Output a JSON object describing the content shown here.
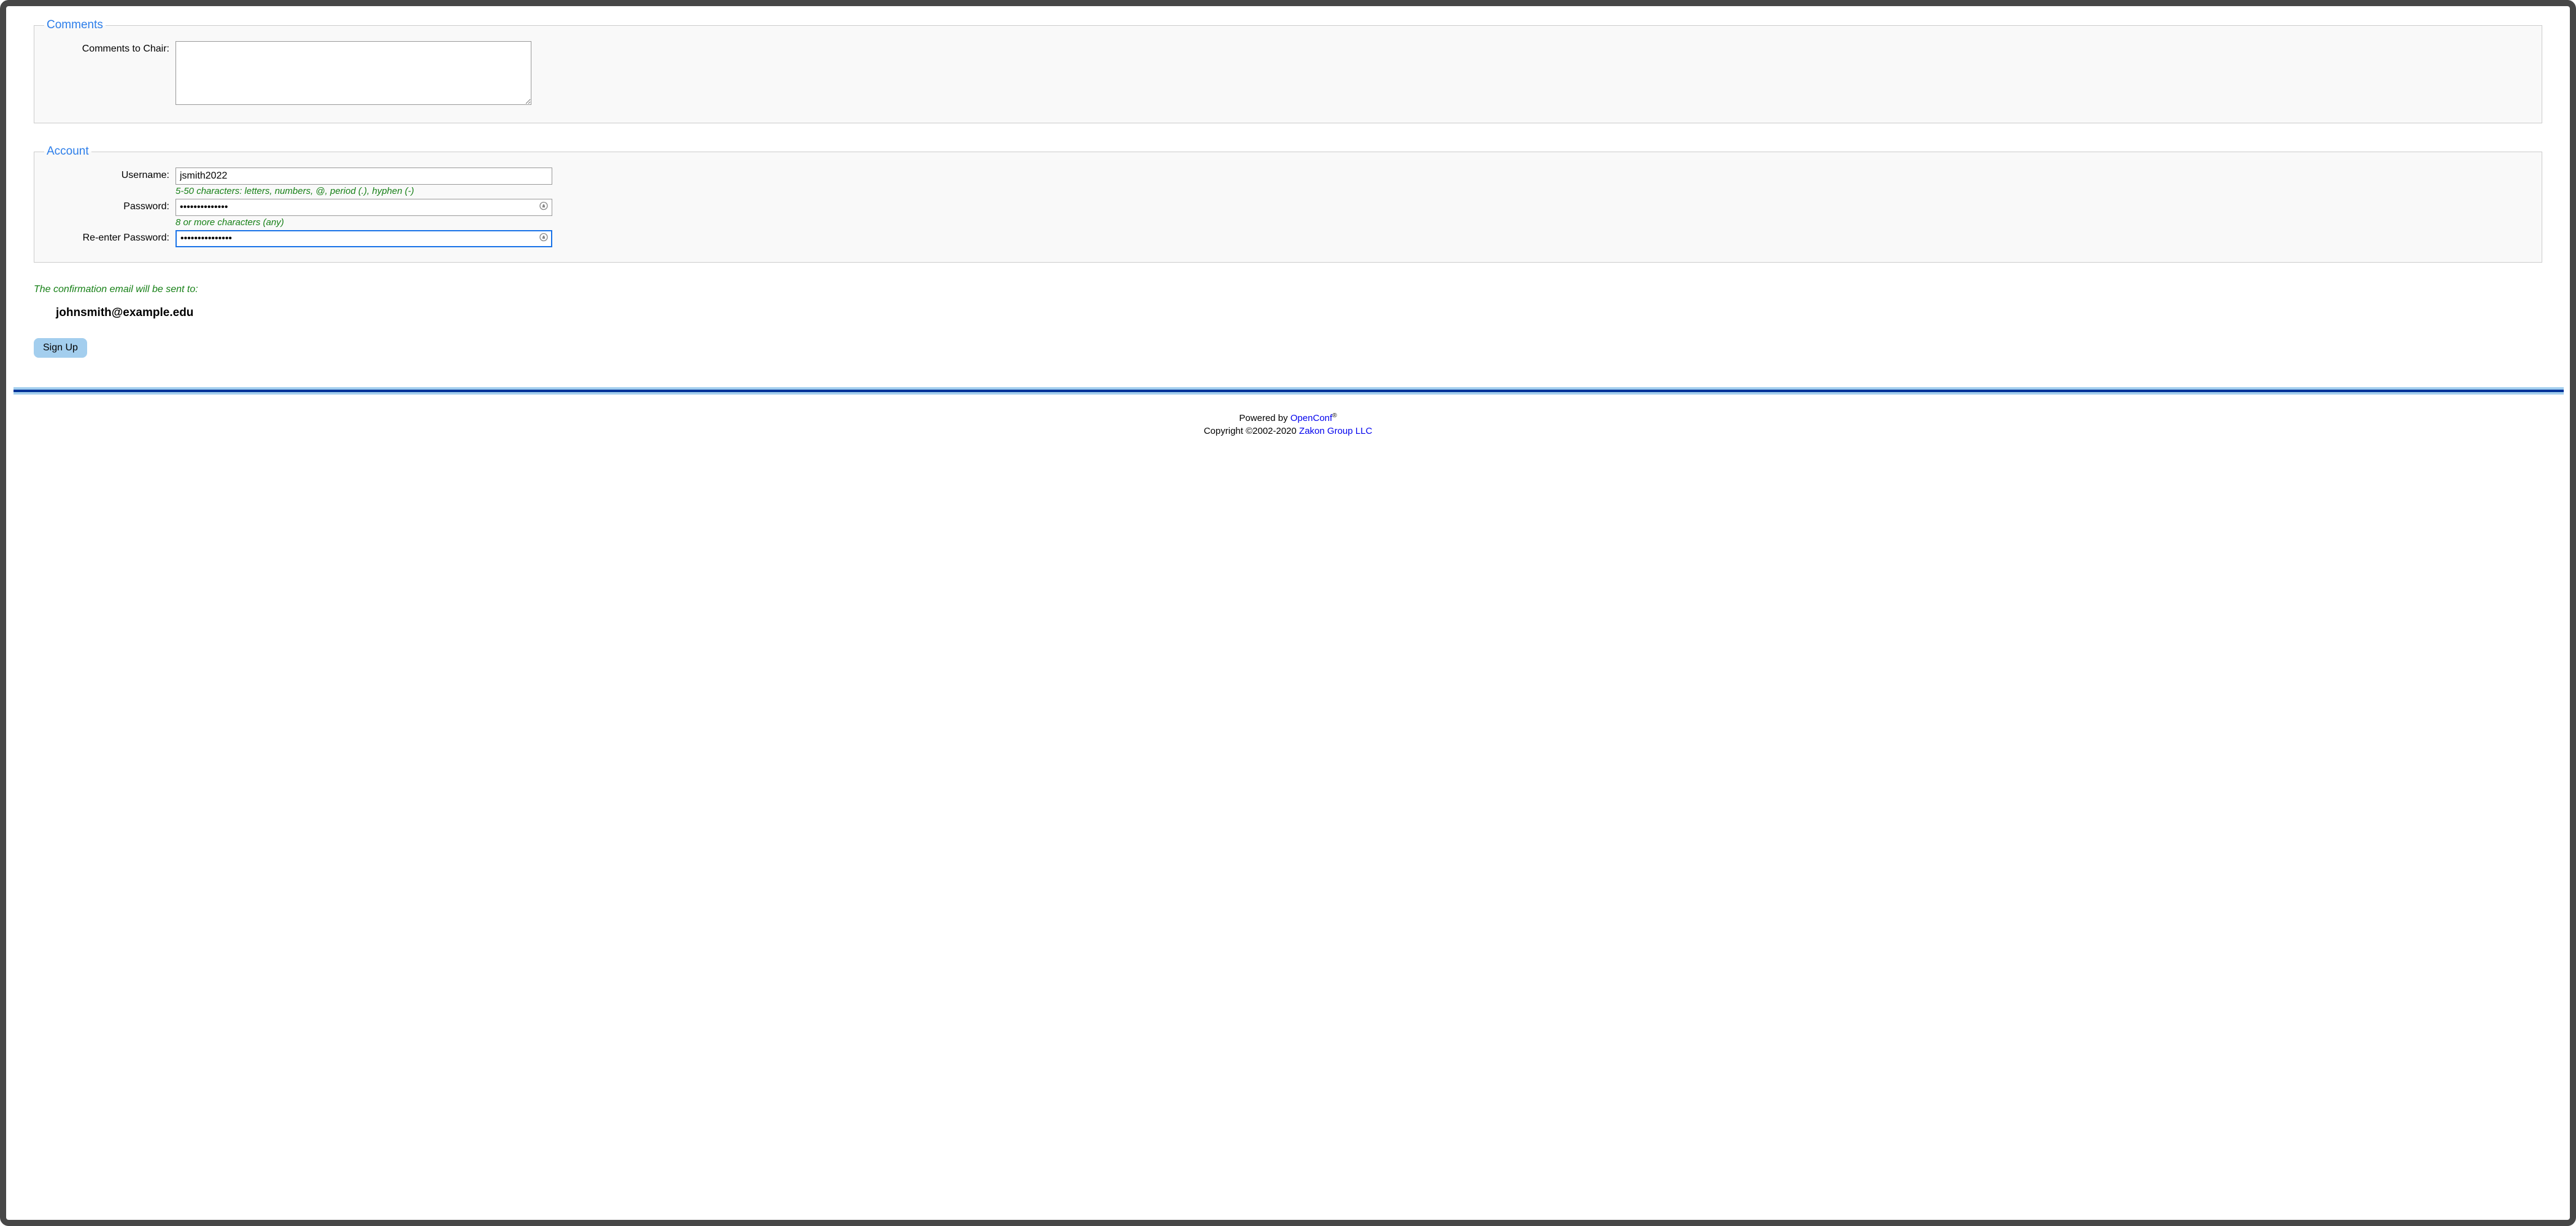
{
  "comments": {
    "legend": "Comments",
    "label": "Comments to Chair:",
    "value": ""
  },
  "account": {
    "legend": "Account",
    "username": {
      "label": "Username:",
      "value": "jsmith2022",
      "hint": "5-50 characters: letters, numbers, @, period (.), hyphen (-)"
    },
    "password": {
      "label": "Password:",
      "value": "••••••••••••••",
      "hint": "8 or more characters (any)"
    },
    "password2": {
      "label": "Re-enter Password:",
      "value": "•••••••••••••••"
    }
  },
  "confirmation": {
    "text": "The confirmation email will be sent to:",
    "email": "johnsmith@example.edu"
  },
  "submit": {
    "label": "Sign Up"
  },
  "footer": {
    "powered_pre": "Powered by ",
    "powered_link": "OpenConf",
    "reg": "®",
    "copyright_pre": "Copyright ©2002-2020 ",
    "copyright_link": "Zakon Group LLC"
  }
}
